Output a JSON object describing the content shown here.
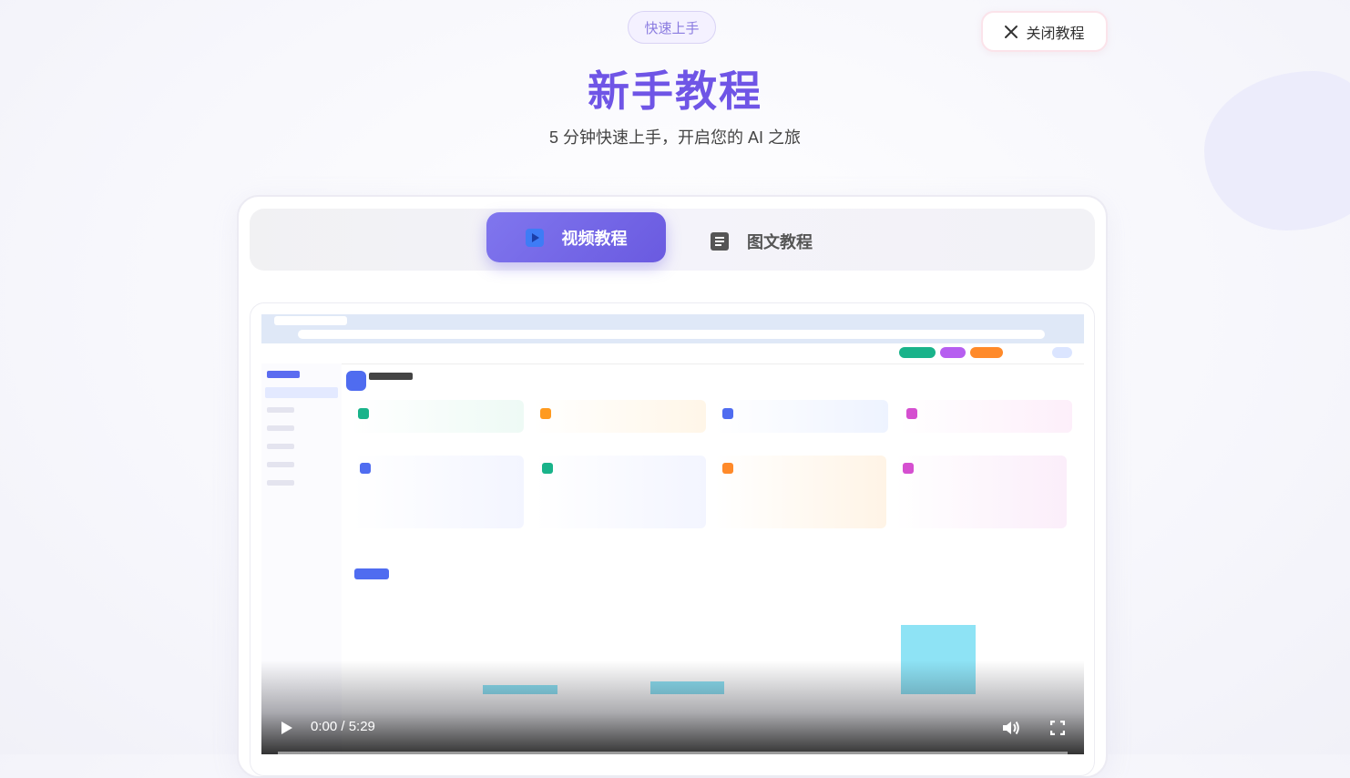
{
  "badge": "快速上手",
  "close_button": {
    "label": "关闭教程",
    "icon": "close-icon"
  },
  "title": "新手教程",
  "subtitle": "5 分钟快速上手，开启您的 AI 之旅",
  "tabs": [
    {
      "label": "视频教程",
      "icon": "play-video-icon",
      "active": true
    },
    {
      "label": "图文教程",
      "icon": "document-icon",
      "active": false
    }
  ],
  "player": {
    "current_time": "0:00",
    "separator": "/",
    "duration": "5:29",
    "time_display": "0:00 / 5:29",
    "progress": 0.0,
    "icons": [
      "play-icon",
      "volume-icon",
      "fullscreen-icon"
    ]
  },
  "colors": {
    "accent": "#6f55e6",
    "tab_active": "#7466ea",
    "badge_text": "#8a7be0"
  }
}
